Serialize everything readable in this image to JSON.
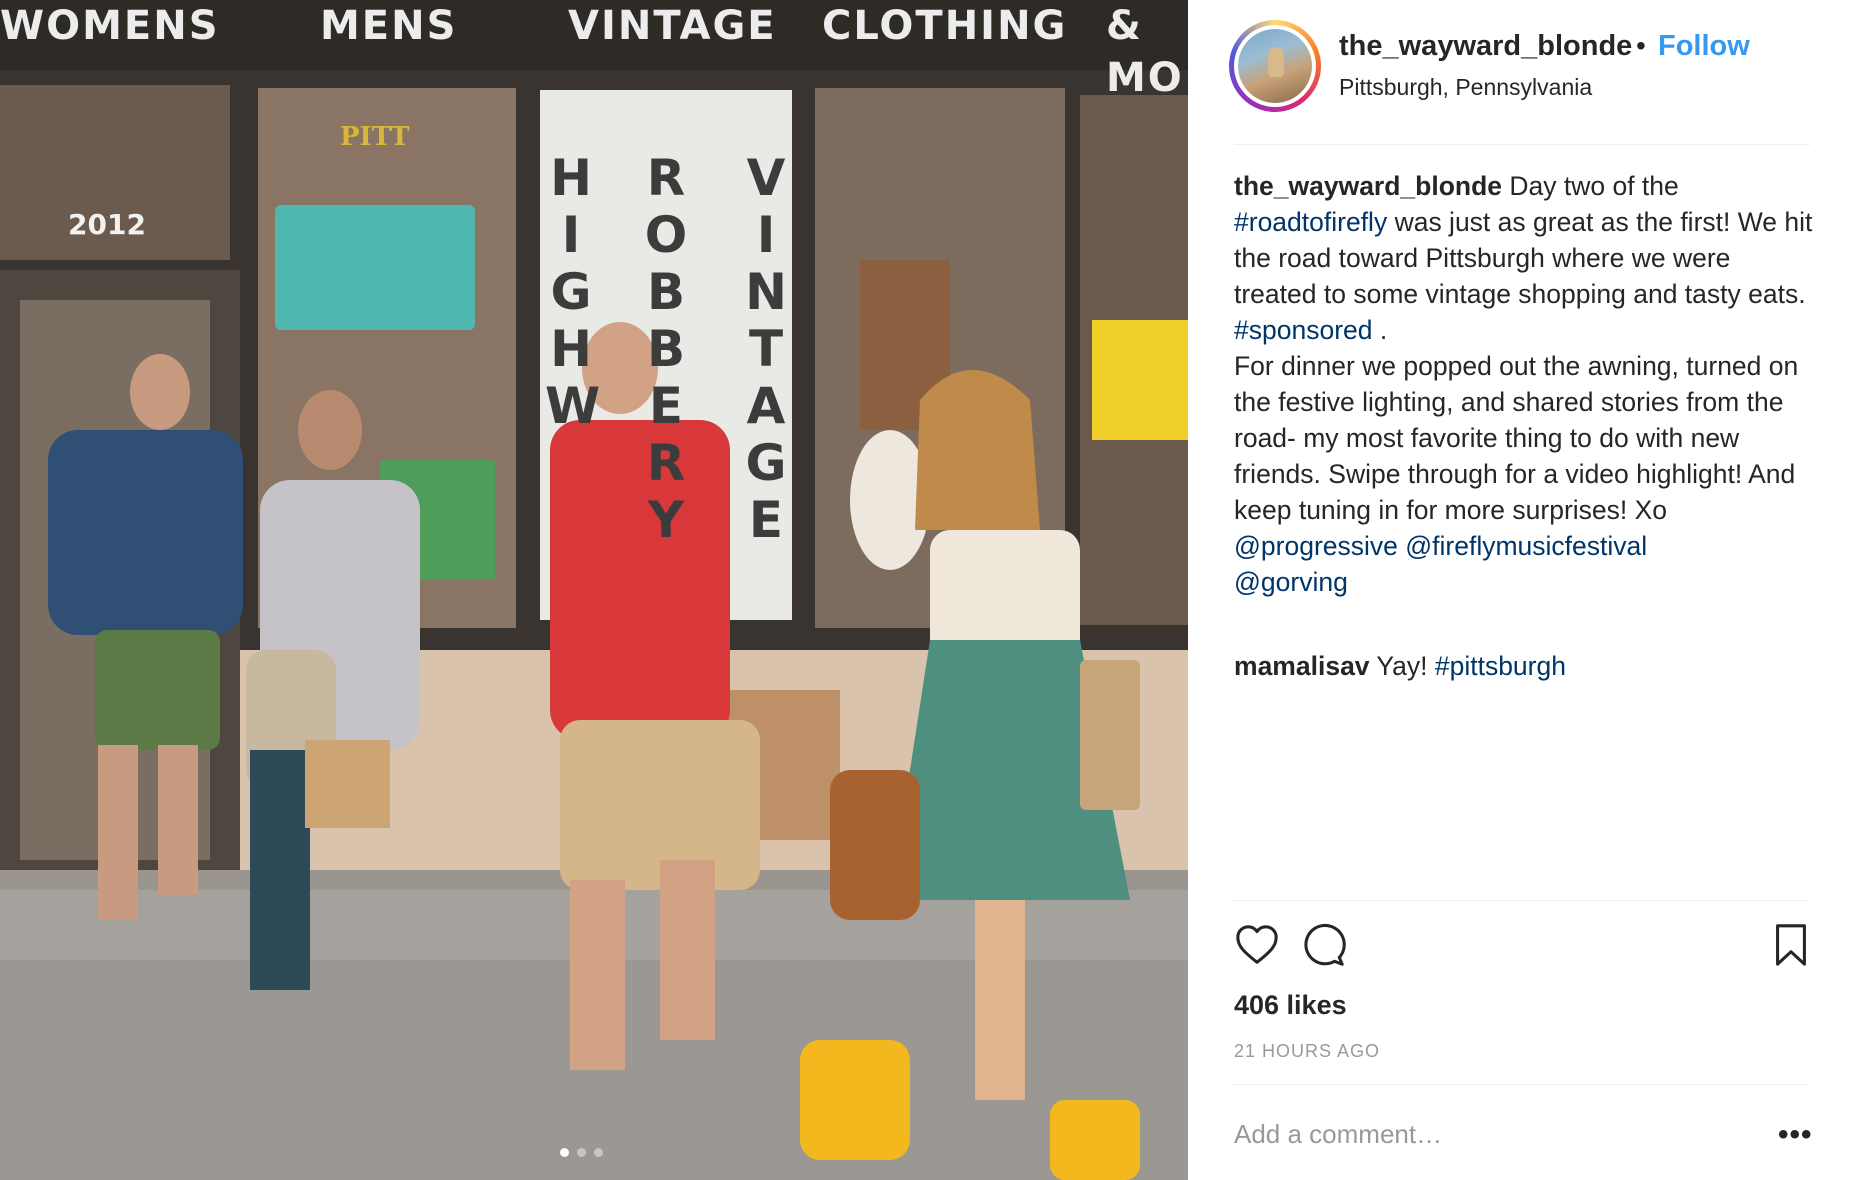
{
  "photo": {
    "sign": [
      "WOMENS",
      "MENS",
      "VINTAGE",
      "CLOTHING",
      "& MO"
    ],
    "banner_columns": [
      "HIGHW",
      "ROBBERY",
      "VINTAGE"
    ],
    "door_year": "2012",
    "shirt_logo": "PITT",
    "carousel_dots": 3,
    "carousel_active": 1
  },
  "header": {
    "username": "the_wayward_blonde",
    "separator": "•",
    "follow_label": "Follow",
    "location": "Pittsburgh, Pennsylvania"
  },
  "caption": {
    "username": "the_wayward_blonde",
    "t1": " Day two of the ",
    "tag1": "#roadtofirefly",
    "t2": " was just as great as the first! We hit the road toward Pittsburgh where we were treated to some vintage shopping and tasty eats. ",
    "tag2": "#sponsored",
    "t3": " .",
    "p2": "For dinner we popped out the awning, turned on the festive lighting, and shared stories from the road- my most favorite thing to do with new friends. Swipe through for a video highlight! And keep tuning in for more surprises! Xo",
    "mention1": "@progressive",
    "mention2": "@fireflymusicfestival",
    "mention3": "@gorving"
  },
  "comments": [
    {
      "username": "mamalisav",
      "text": " Yay! ",
      "tag": "#pittsburgh"
    }
  ],
  "actions": {
    "like_icon": "heart-icon",
    "comment_icon": "comment-bubble-icon",
    "save_icon": "bookmark-icon"
  },
  "stats": {
    "likes": "406 likes",
    "time": "21 HOURS AGO"
  },
  "add_comment": {
    "placeholder": "Add a comment…",
    "more": "•••"
  },
  "colors": {
    "link": "#003569",
    "follow": "#3897f0",
    "muted": "#999999",
    "text": "#262626"
  }
}
